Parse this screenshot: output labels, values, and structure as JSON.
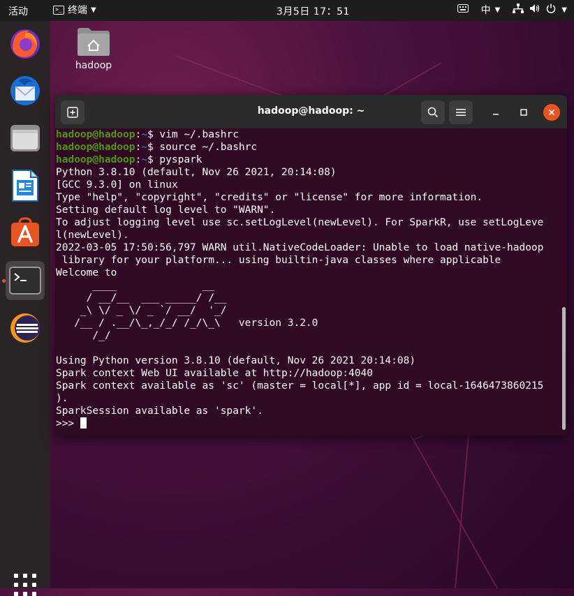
{
  "topbar": {
    "activities": "活动",
    "app_name": "终端",
    "clock": "3月5日  17：51",
    "input_method": "中"
  },
  "dock": {
    "apps": [
      {
        "name": "Firefox"
      },
      {
        "name": "Thunderbird"
      },
      {
        "name": "Files"
      },
      {
        "name": "LibreOffice Writer"
      },
      {
        "name": "Ubuntu Software"
      },
      {
        "name": "Terminal"
      },
      {
        "name": "Eclipse"
      }
    ]
  },
  "desktop": {
    "home_folder_label": "hadoop"
  },
  "terminal": {
    "title": "hadoop@hadoop: ~",
    "prompt_user": "hadoop@hadoop",
    "prompt_path": "~",
    "commands": [
      " vim ~/.bashrc",
      " source ~/.bashrc",
      " pyspark"
    ],
    "output": [
      "Python 3.8.10 (default, Nov 26 2021, 20:14:08)",
      "[GCC 9.3.0] on linux",
      "Type \"help\", \"copyright\", \"credits\" or \"license\" for more information.",
      "Setting default log level to \"WARN\".",
      "To adjust logging level use sc.setLogLevel(newLevel). For SparkR, use setLogLeve",
      "l(newLevel).",
      "2022-03-05 17:50:56,797 WARN util.NativeCodeLoader: Unable to load native-hadoop",
      " library for your platform... using builtin-java classes where applicable",
      "Welcome to",
      "      ____              __",
      "     / __/__  ___ _____/ /__",
      "    _\\ \\/ _ \\/ _ `/ __/  '_/",
      "   /__ / .__/\\_,_/_/ /_/\\_\\   version 3.2.0",
      "      /_/",
      "",
      "Using Python version 3.8.10 (default, Nov 26 2021 20:14:08)",
      "Spark context Web UI available at http://hadoop:4040",
      "Spark context available as 'sc' (master = local[*], app id = local-1646473860215",
      ").",
      "SparkSession available as 'spark'."
    ],
    "repl_prompt": ">>> "
  },
  "colors": {
    "terminal_bg": "#300a24",
    "prompt_user": "#4e9a06",
    "prompt_path": "#3465a4",
    "close_button": "#e95420",
    "accent": "#e95420"
  }
}
